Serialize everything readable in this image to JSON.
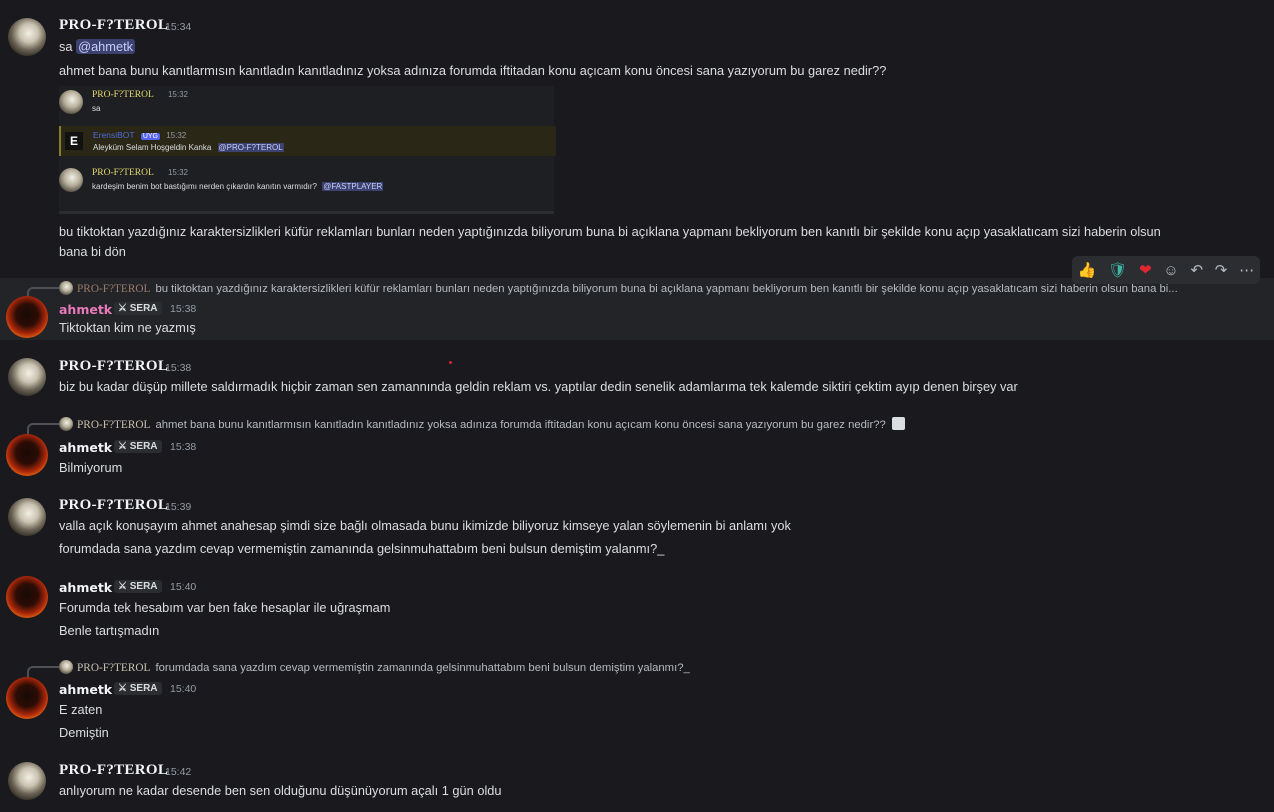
{
  "users": {
    "pro": "PRO-F?TEROL",
    "ahmet": "ahmetk",
    "ahmet_tag": "SERA"
  },
  "messages": {
    "m1": {
      "time": "15:34",
      "line1_prefix": "sa ",
      "mention": "@ahmetk",
      "line2": "ahmet bana bunu kanıtlarmısın kanıtladın kanıtladınız yoksa adınıza forumda iftitadan konu açıcam konu öncesi sana yazıyorum bu garez nedir??",
      "line3": "bu tiktoktan yazdığınız karaktersizlikleri küfür reklamları bunları neden yaptığınızda biliyorum buna bi açıklana yapmanı bekliyorum ben kanıtlı bir şekilde konu açıp yasaklatıcam sizi haberin olsun",
      "line4": "bana bi dön"
    },
    "embed": {
      "r1_name": "PRO-F?TEROL",
      "r1_time": "15:32",
      "r1_text": "sa",
      "bot_name": "ErensiBOT",
      "bot_badge": "UYG",
      "bot_time": "15:32",
      "bot_text": "Aleyküm Selam Hoşgeldin Kanka",
      "bot_mention": "@PRO-F?TEROL",
      "r3_name": "PRO-F?TEROL",
      "r3_time": "15:32",
      "r3_text": "kardeşim benim bot  bastığımı nerden çıkardın kanıtın varmıdır?",
      "r3_mention": "@FASTPLAYER"
    },
    "m2": {
      "reply_name": "PRO-F?TEROL",
      "reply_text": "bu tiktoktan yazdığınız karaktersizlikleri küfür reklamları bunları neden yaptığınızda biliyorum buna bi açıklana yapmanı bekliyorum ben kanıtlı bir şekilde konu açıp yasaklatıcam sizi haberin olsun bana bi...",
      "time": "15:38",
      "line1": "Tiktoktan kim ne yazmış"
    },
    "m3": {
      "time": "15:38",
      "line1": "biz bu  kadar düşüp millete saldırmadık hiçbir zaman sen zamannında geldin reklam vs. yaptılar dedin senelik adamlarıma tek kalemde siktiri çektim ayıp denen birşey var"
    },
    "m4": {
      "reply_name": "PRO-F?TEROL",
      "reply_text": "ahmet bana bunu kanıtlarmısın kanıtladın kanıtladınız yoksa adınıza forumda iftitadan konu açıcam konu öncesi sana yazıyorum bu garez nedir??",
      "time": "15:38",
      "line1": "Bilmiyorum"
    },
    "m5": {
      "time": "15:39",
      "line1": "valla açık konuşayım ahmet anahesap şimdi size bağlı olmasada bunu ikimizde biliyoruz kimseye yalan söylemenin bi anlamı yok",
      "line2": "forumdada sana yazdım cevap vermemiştin zamanında gelsinmuhattabım beni bulsun demiştim yalanmı?_"
    },
    "m6": {
      "time": "15:40",
      "line1": "Forumda tek hesabım var ben fake hesaplar ile uğraşmam",
      "line2": "Benle tartışmadın"
    },
    "m7": {
      "reply_name": "PRO-F?TEROL",
      "reply_text": "forumdada sana yazdım cevap vermemiştin zamanında gelsinmuhattabım beni bulsun demiştim yalanmı?_",
      "time": "15:40",
      "line1": "E zaten",
      "line2": "Demiştin"
    },
    "m8": {
      "time": "15:42",
      "line1": "anlıyorum ne kadar desende ben sen olduğunu düşünüyorum açalı 1 gün oldu"
    }
  },
  "toolbar": {
    "icons": [
      "thumbs-up-emoji",
      "shield-check-emoji",
      "heart-emoji",
      "add-reaction-icon",
      "reply-icon",
      "forward-icon",
      "more-icon"
    ],
    "thumbs": "👍",
    "shield": "🛡",
    "heart": "❤",
    "add": "☺",
    "reply": "↶",
    "forward": "↷",
    "more": "⋯"
  },
  "colors": {
    "background": "#1a1a1e",
    "mention_bg": "#3c4270",
    "mention_fg": "#c9cdfb",
    "hover_row": "#232428"
  }
}
